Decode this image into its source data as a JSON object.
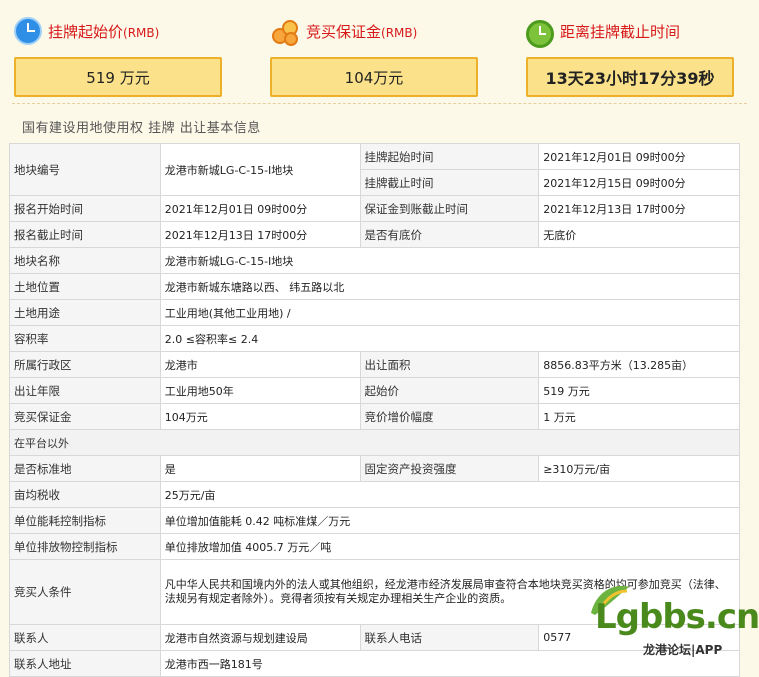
{
  "summary": {
    "start_price_title": "挂牌起始价",
    "start_price_unit": "(RMB)",
    "start_price_value": "519  万元",
    "deposit_title": "竞买保证金",
    "deposit_unit": "(RMB)",
    "deposit_value": "104万元",
    "countdown_title": "距离挂牌截止时间",
    "countdown_value": "13天23小时17分39秒"
  },
  "section_title": "国有建设用地使用权 挂牌 出让基本信息",
  "table": {
    "parcel_no_label": "地块编号",
    "parcel_no": "龙港市新城LG-C-15-I地块",
    "list_start_label": "挂牌起始时间",
    "list_start": "2021年12月01日 09时00分",
    "list_end_label": "挂牌截止时间",
    "list_end": "2021年12月15日 09时00分",
    "reg_start_label": "报名开始时间",
    "reg_start": "2021年12月01日 09时00分",
    "deposit_deadline_label": "保证金到账截止时间",
    "deposit_deadline": "2021年12月13日 17时00分",
    "reg_end_label": "报名截止时间",
    "reg_end": "2021年12月13日 17时00分",
    "reserve_label": "是否有底价",
    "reserve": "无底价",
    "name_label": "地块名称",
    "name": "龙港市新城LG-C-15-I地块",
    "location_label": "土地位置",
    "location": "龙港市新城东塘路以西、 纬五路以北",
    "usage_label": "土地用途",
    "usage": "工业用地(其他工业用地) /",
    "far_label": "容积率",
    "far": "2.0 ≤容积率≤ 2.4",
    "district_label": "所属行政区",
    "district": "龙港市",
    "area_label": "出让面积",
    "area": "8856.83平方米（13.285亩）",
    "term_label": "出让年限",
    "term": "工业用地50年",
    "start_price_label": "起始价",
    "start_price": "519 万元",
    "deposit_label": "竞买保证金",
    "deposit": "104万元",
    "increment_label": "竞价增价幅度",
    "increment": "1 万元",
    "platform_label": "在平台以外",
    "standard_label": "是否标准地",
    "standard": "是",
    "fixed_invest_label": "固定资产投资强度",
    "fixed_invest": "≥310万元/亩",
    "tax_label": "亩均税收",
    "tax": "25万元/亩",
    "energy_label": "单位能耗控制指标",
    "energy": "单位增加值能耗 0.42 吨标准煤／万元",
    "emission_label": "单位排放物控制指标",
    "emission": "单位排放增加值 4005.7 万元／吨",
    "bidder_label": "竞买人条件",
    "bidder": "凡中华人民共和国境内外的法人或其他组织，经龙港市经济发展局审查符合本地块竞买资格的均可参加竞买（法律、法规另有规定者除外）。竞得者须按有关规定办理相关生产企业的资质。",
    "contact_label": "联系人",
    "contact": "龙港市自然资源与规划建设局",
    "phone_label": "联系人电话",
    "phone": "0577",
    "address_label": "联系人地址",
    "address": "龙港市西一路181号"
  },
  "watermark": {
    "brand": "Lgbbs.cn",
    "sub": "龙港论坛|APP"
  }
}
